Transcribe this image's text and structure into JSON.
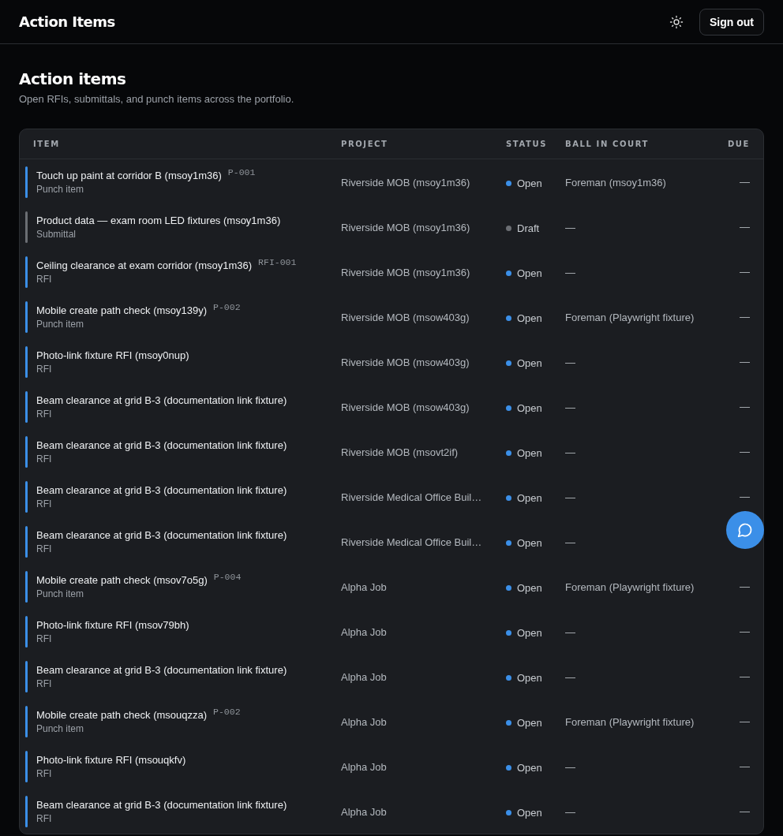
{
  "app_bar": {
    "title": "Action Items",
    "sign_out": "Sign out"
  },
  "page": {
    "title": "Action items",
    "subtitle": "Open RFIs, submittals, and punch items across the portfolio."
  },
  "table": {
    "columns": [
      "ITEM",
      "PROJECT",
      "STATUS",
      "BALL IN COURT",
      "DUE"
    ],
    "rows": [
      {
        "title": "Touch up paint at corridor B (msoy1m36)",
        "code": "P-001",
        "type": "Punch item",
        "project": "Riverside MOB (msoy1m36)",
        "status": "Open",
        "color": "#3b8fe8",
        "ball_in_court": "Foreman (msoy1m36)",
        "due": "—"
      },
      {
        "title": "Product data — exam room LED fixtures (msoy1m36)",
        "type": "Submittal",
        "project": "Riverside MOB (msoy1m36)",
        "status": "Draft",
        "color": "#6b6e73",
        "ball_in_court": "—",
        "due": "—"
      },
      {
        "title": "Ceiling clearance at exam corridor (msoy1m36)",
        "rfi_number": "RFI-001",
        "type": "RFI",
        "project": "Riverside MOB (msoy1m36)",
        "status": "Open",
        "color": "#3b8fe8",
        "ball_in_court": "—",
        "due": "—"
      },
      {
        "title": "Mobile create path check (msoy139y)",
        "code": "P-002",
        "type": "Punch item",
        "project": "Riverside MOB (msow403g)",
        "status": "Open",
        "color": "#3b8fe8",
        "ball_in_court": "Foreman (Playwright fixture)",
        "due": "—"
      },
      {
        "title": "Photo-link fixture RFI (msoy0nup)",
        "type": "RFI",
        "project": "Riverside MOB (msow403g)",
        "status": "Open",
        "color": "#3b8fe8",
        "ball_in_court": "—",
        "due": "—"
      },
      {
        "title": "Beam clearance at grid B-3 (documentation link fixture)",
        "type": "RFI",
        "project": "Riverside MOB (msow403g)",
        "status": "Open",
        "color": "#3b8fe8",
        "ball_in_court": "—",
        "due": "—"
      },
      {
        "title": "Beam clearance at grid B-3 (documentation link fixture)",
        "type": "RFI",
        "project": "Riverside MOB (msovt2if)",
        "status": "Open",
        "color": "#3b8fe8",
        "ball_in_court": "—",
        "due": "—"
      },
      {
        "title": "Beam clearance at grid B-3 (documentation link fixture)",
        "type": "RFI",
        "project": "Riverside Medical Office Buil…",
        "status": "Open",
        "color": "#3b8fe8",
        "ball_in_court": "—",
        "due": "—"
      },
      {
        "title": "Beam clearance at grid B-3 (documentation link fixture)",
        "type": "RFI",
        "project": "Riverside Medical Office Buil…",
        "status": "Open",
        "color": "#3b8fe8",
        "ball_in_court": "—"
      },
      {
        "title": "Mobile create path check (msov7o5g)",
        "code": "P-004",
        "type": "Punch item",
        "project": "Alpha Job",
        "status": "Open",
        "color": "#3b8fe8",
        "ball_in_court": "Foreman (Playwright fixture)",
        "due": "—"
      },
      {
        "title": "Photo-link fixture RFI (msov79bh)",
        "type": "RFI",
        "project": "Alpha Job",
        "status": "Open",
        "color": "#3b8fe8",
        "ball_in_court": "—",
        "due": "—"
      },
      {
        "title": "Beam clearance at grid B-3 (documentation link fixture)",
        "type": "RFI",
        "project": "Alpha Job",
        "status": "Open",
        "color": "#3b8fe8",
        "ball_in_court": "—",
        "due": "—"
      },
      {
        "title": "Mobile create path check (msouqzza)",
        "code": "P-002",
        "type": "Punch item",
        "project": "Alpha Job",
        "status": "Open",
        "color": "#3b8fe8",
        "ball_in_court": "Foreman (Playwright fixture)",
        "due": "—"
      },
      {
        "title": "Photo-link fixture RFI (msouqkfv)",
        "type": "RFI",
        "project": "Alpha Job",
        "status": "Open",
        "color": "#3b8fe8",
        "ball_in_court": "—",
        "due": "—"
      },
      {
        "title": "Beam clearance at grid B-3 (documentation link fixture)",
        "type": "RFI",
        "project": "Alpha Job",
        "status": "Open",
        "color": "#3b8fe8",
        "ball_in_court": "—",
        "due": "—"
      }
    ]
  }
}
